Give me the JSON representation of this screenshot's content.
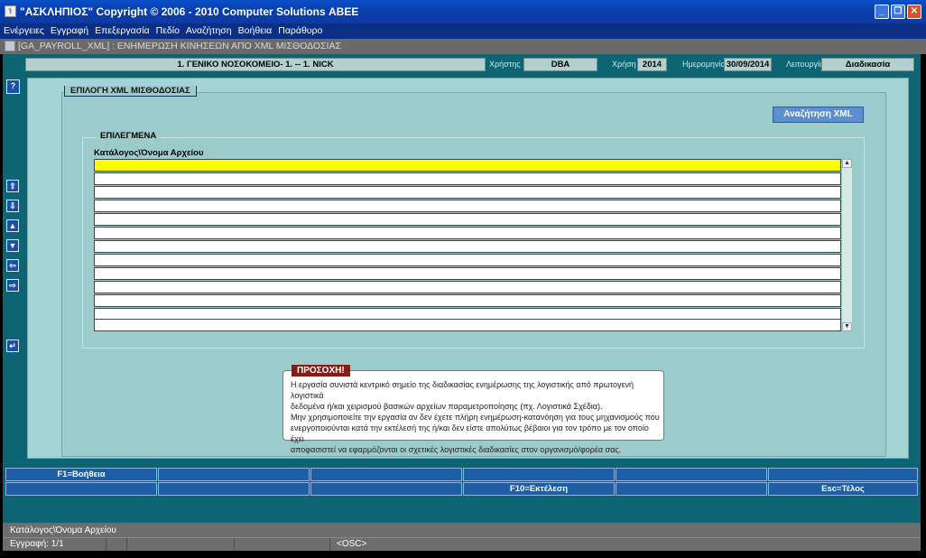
{
  "window": {
    "title": "\"ΑΣΚΛΗΠΙΟΣ\" Copyright © 2006 - 2010 Computer Solutions ΑΒΕΕ",
    "minimize": "_",
    "restore": "❐",
    "close": "✕"
  },
  "menu": [
    "Ενέργειες",
    "Εγγραφή",
    "Επεξεργασία",
    "Πεδίο",
    "Αναζήτηση",
    "Βοήθεια",
    "Παράθυρο"
  ],
  "form_title": "[GA_PAYROLL_XML]  :  ΕΝΗΜΕΡΩΣΗ ΚΙΝΗΣΕΩΝ ΑΠΟ XML ΜΙΣΘΟΔΟΣΙΑΣ",
  "info": {
    "organization": "1. ΓΕΝΙΚΟ ΝΟΣΟΚΟΜΕΙΟ- 1. -- 1. NICK",
    "user_label": "Χρήστης",
    "user": "DBA",
    "year_label": "Χρήση",
    "year": "2014",
    "date_label": "Ημερομηνία",
    "date": "30/09/2014",
    "function_label": "Λειτουργία",
    "function": "Διαδικασία"
  },
  "side_buttons": [
    "?",
    "⇧",
    "⇩",
    "▲",
    "▼",
    "⇦",
    "⇨",
    "↵"
  ],
  "frame_title": "ΕΠΙΛΟΓΗ XML ΜΙΣΘΟΔΟΣΙΑΣ",
  "search_button": "Αναζήτηση XML",
  "selected": {
    "title": "ΕΠΙΛΕΓΜΕΝΑ",
    "column": "Κατάλογος\\Όνομα Αρχείου",
    "rows": [
      "",
      "",
      "",
      "",
      "",
      "",
      "",
      "",
      "",
      "",
      "",
      "",
      ""
    ]
  },
  "scroll": {
    "up": "▲",
    "down": "▼"
  },
  "notice": {
    "title": "ΠΡΟΣΟΧΗ!",
    "lines": [
      "Η εργασία συνιστά κεντρικό σημείο της διαδικασίας ενημέρωσης της λογιστικής από πρωτογενή λογιστικά",
      "δεδομένα ή/και χειρισμού βασικών αρχείων παραμετροποίησης (πχ. Λογιστικά Σχέδια).",
      "Μην χρησιμοποιείτε την εργασία αν δεν έχετε πλήρη ενημέρωση-κατανόηση για τους μηχανισμούς που",
      "ενεργοποιούνται κατά την εκτέλεσή της ή/και δεν είστε απολύτως βέβαιοι για τον τρόπο με τον οποίο έχει",
      "αποφασιστεί να εφαρμόζονται οι σχετικές λογιστικές διαδικασίες στον οργανισμό/φορέα σας."
    ]
  },
  "fkeys_row1": [
    "F1=Βοήθεια",
    "",
    "",
    "",
    "",
    ""
  ],
  "fkeys_row2": [
    "",
    "",
    "",
    "F10=Εκτέλεση",
    "",
    "Esc=Τέλος"
  ],
  "status": {
    "field": "Κατάλογος\\Όνομα Αρχείου",
    "record": "Εγγραφή: 1/1",
    "mode": "<OSC>"
  }
}
